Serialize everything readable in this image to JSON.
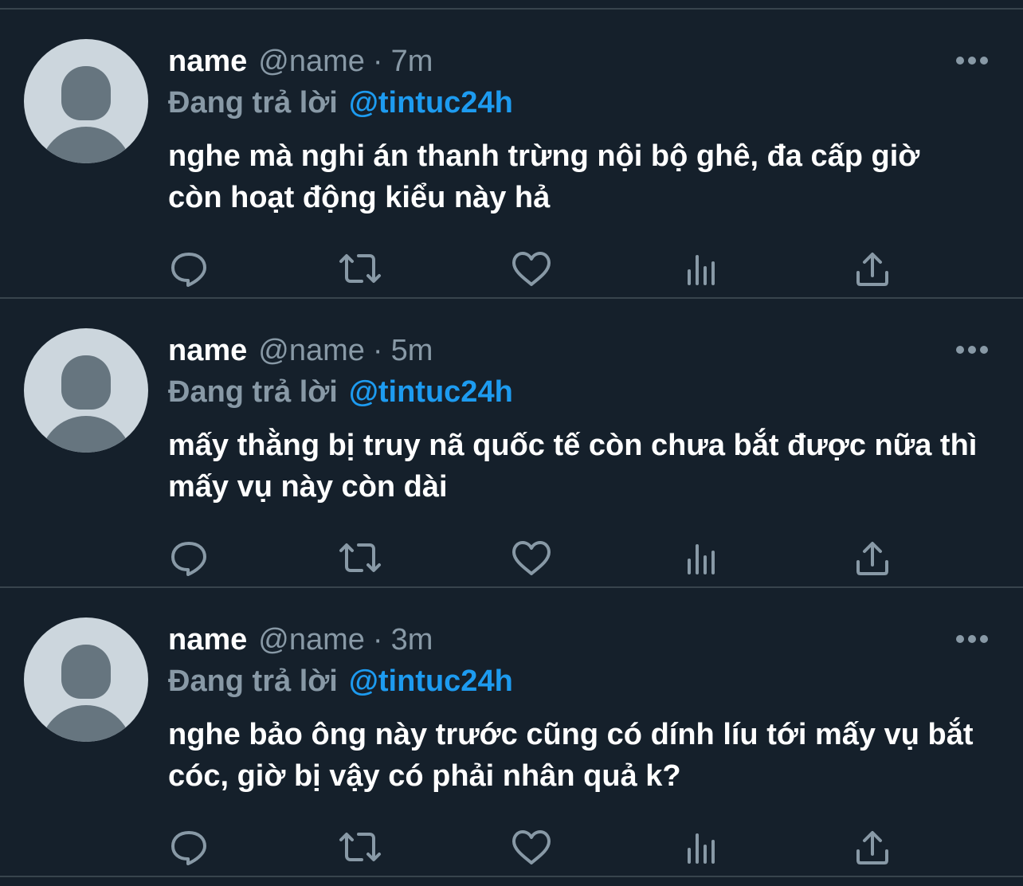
{
  "tweets": [
    {
      "name": "name",
      "handle": "@name",
      "separator": "·",
      "time": "7m",
      "reply_prefix": "Đang trả lời",
      "reply_to": "@tintuc24h",
      "text": "nghe mà nghi án thanh trừng nội bộ ghê, đa cấp giờ còn hoạt động kiểu này hả"
    },
    {
      "name": "name",
      "handle": "@name",
      "separator": "·",
      "time": "5m",
      "reply_prefix": "Đang trả lời",
      "reply_to": "@tintuc24h",
      "text": "mấy thằng bị truy nã quốc tế còn chưa bắt được nữa thì mấy vụ này còn dài"
    },
    {
      "name": "name",
      "handle": "@name",
      "separator": "·",
      "time": "3m",
      "reply_prefix": "Đang trả lời",
      "reply_to": "@tintuc24h",
      "text": "nghe bảo ông này trước cũng có dính líu tới mấy vụ bắt cóc, giờ bị vậy có phải nhân quả k?"
    }
  ],
  "icons": {
    "more": "more-horizontal-icon",
    "reply": "reply-bubble-icon",
    "retweet": "retweet-icon",
    "like": "heart-icon",
    "analytics": "analytics-bars-icon",
    "share": "share-upload-icon"
  },
  "colors": {
    "background": "#15202b",
    "divider": "#38444d",
    "text": "#ffffff",
    "secondary": "#8899a6",
    "mention": "#1d9bf0"
  }
}
